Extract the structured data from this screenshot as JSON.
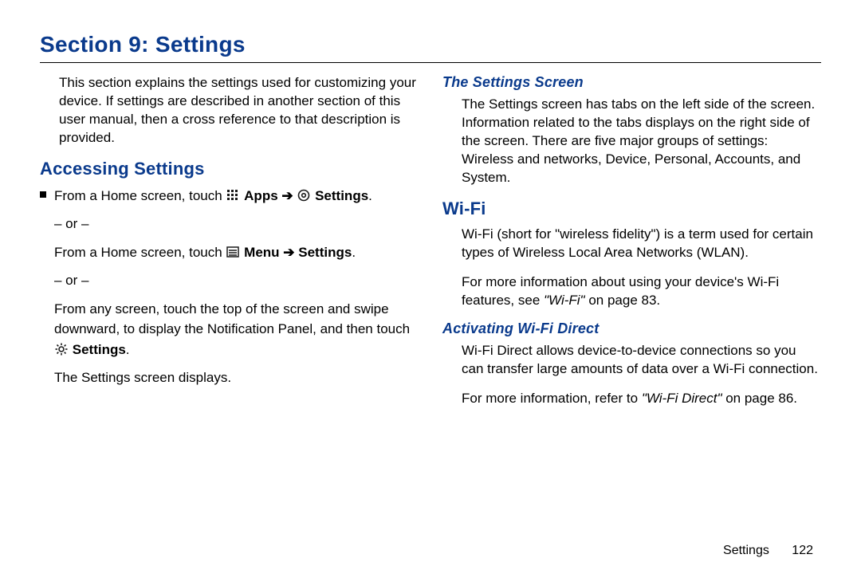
{
  "page_title": "Section 9: Settings",
  "intro": "This section explains the settings used for customizing your device. If settings are described in another section of this user manual, then a cross reference to that description is provided.",
  "left": {
    "h2": "Accessing Settings",
    "line1_a": "From a Home screen, touch ",
    "apps_bold": "Apps",
    "arrow": " ➔ ",
    "settings_bold": "Settings",
    "period": ".",
    "or": "– or –",
    "line2_a": "From a Home screen, touch ",
    "menu_bold": "Menu",
    "line3": "From any screen, touch the top of the screen and swipe downward, to display the Notification Panel, and then touch ",
    "line4": "The Settings screen displays."
  },
  "right": {
    "h3a": "The Settings Screen",
    "p_a": "The Settings screen has tabs on the left side of the screen. Information related to the tabs displays on the right side of the screen. There are five major groups of settings: Wireless and networks, Device, Personal, Accounts, and System.",
    "h2": "Wi-Fi",
    "p_b": "Wi-Fi (short for \"wireless fidelity\") is a term used for certain types of Wireless Local Area Networks (WLAN).",
    "p_c_a": "For more information about using your device's Wi-Fi features, see ",
    "p_c_ref": "\"Wi-Fi\"",
    "p_c_b": " on page 83.",
    "h3b": "Activating Wi-Fi Direct",
    "p_d": "Wi-Fi Direct allows device-to-device connections so you can transfer large amounts of data over a Wi-Fi connection.",
    "p_e_a": "For more information, refer to ",
    "p_e_ref": "\"Wi-Fi Direct\"",
    "p_e_b": " on page 86."
  },
  "footer": {
    "section": "Settings",
    "page": "122"
  }
}
